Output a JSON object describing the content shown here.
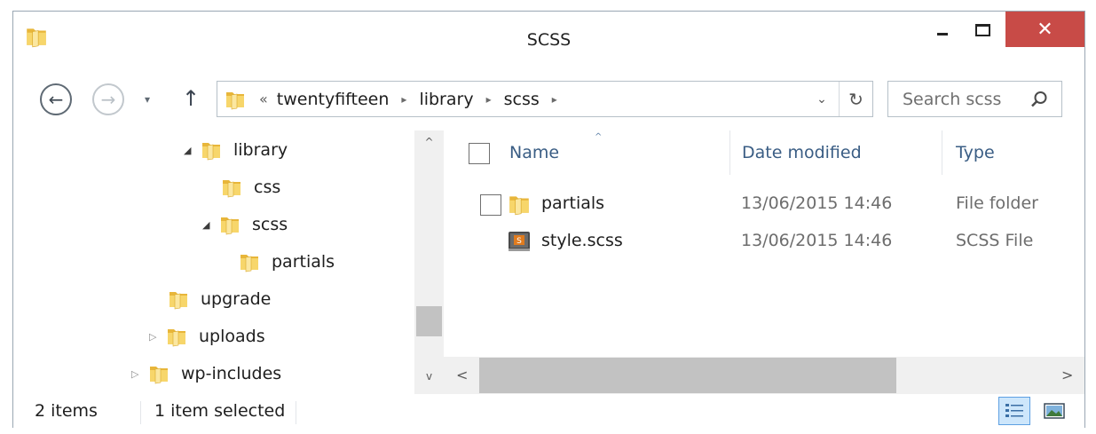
{
  "window": {
    "title": "SCSS"
  },
  "titlebar": {
    "minimize_icon": "minimize-icon",
    "maximize_icon": "maximize-icon",
    "close_label": "✕"
  },
  "nav": {
    "back_glyph": "←",
    "forward_glyph": "→",
    "recent_glyph": "▾",
    "up_glyph": "↑",
    "address": {
      "prefix": "«",
      "breadcrumbs": [
        "twentyfifteen",
        "library",
        "scss"
      ],
      "separator": "▸",
      "dropdown_glyph": "⌄",
      "refresh_glyph": "↻"
    },
    "search_placeholder": "Search scss"
  },
  "tree": {
    "items": [
      {
        "label": "library",
        "arrow": "◢",
        "state": "expanded"
      },
      {
        "label": "css",
        "arrow": "",
        "state": "leaf"
      },
      {
        "label": "scss",
        "arrow": "◢",
        "state": "expanded"
      },
      {
        "label": "partials",
        "arrow": "",
        "state": "leaf"
      },
      {
        "label": "upgrade",
        "arrow": "",
        "state": "leaf"
      },
      {
        "label": "uploads",
        "arrow": "▷",
        "state": "collapsed"
      },
      {
        "label": "wp-includes",
        "arrow": "▷",
        "state": "collapsed"
      }
    ],
    "scroll_up": "^",
    "scroll_down": "v"
  },
  "filelist": {
    "columns": {
      "name": "Name",
      "date": "Date modified",
      "type": "Type"
    },
    "sort_glyph": "^",
    "rows": [
      {
        "name": "partials",
        "date": "13/06/2015 14:46",
        "type": "File folder",
        "icon": "folder-icon"
      },
      {
        "name": "style.scss",
        "date": "13/06/2015 14:46",
        "type": "SCSS File",
        "icon": "scss-file-icon"
      }
    ],
    "hscroll_left": "<",
    "hscroll_right": ">"
  },
  "status": {
    "count": "2 items",
    "selected": "1 item selected"
  },
  "colors": {
    "close_button": "#c84b47",
    "header_text": "#3a5d84",
    "folder_yellow": "#f2c94c",
    "selected_view": "#cde6fb"
  }
}
